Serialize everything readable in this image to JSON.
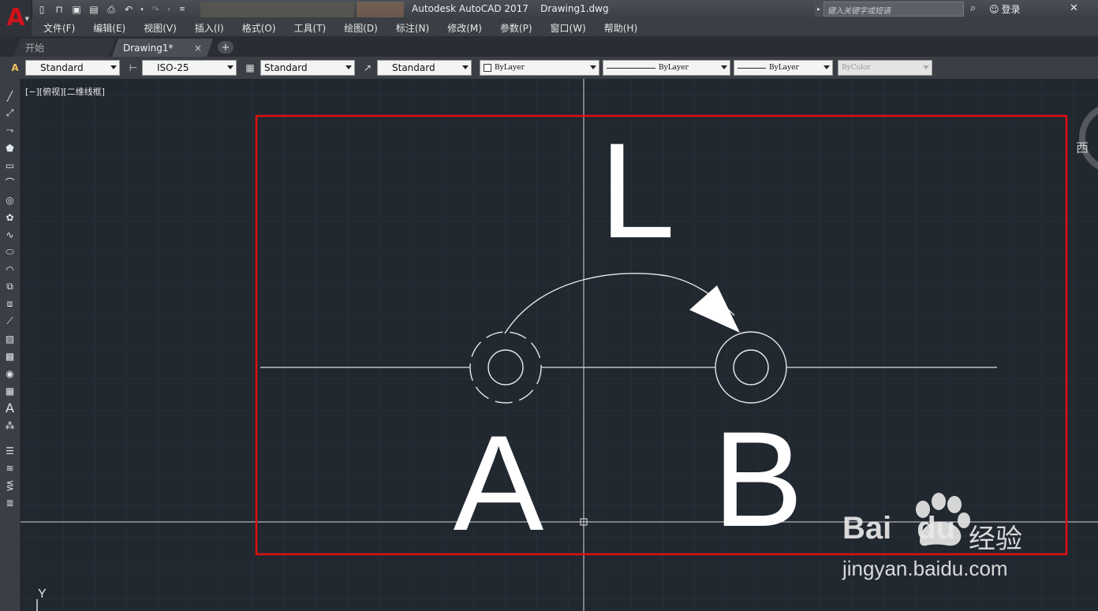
{
  "titlebar": {
    "title": "Autodesk AutoCAD 2017    Drawing1.dwg",
    "search_placeholder": "键入关键字或短语",
    "login": "登录"
  },
  "menu": [
    "文件(F)",
    "编辑(E)",
    "视图(V)",
    "插入(I)",
    "格式(O)",
    "工具(T)",
    "绘图(D)",
    "标注(N)",
    "修改(M)",
    "参数(P)",
    "窗口(W)",
    "帮助(H)"
  ],
  "tabs": {
    "start": "开始",
    "drawing": "Drawing1*",
    "close": "×",
    "add": "+"
  },
  "toolbar": {
    "text_style": "Standard",
    "dim_style": "ISO-25",
    "table_style": "Standard",
    "multileader_style": "Standard",
    "layer_color": "ByLayer",
    "linetype": "ByLayer",
    "lineweight": "ByLayer",
    "plot_style": "ByColor"
  },
  "viewport": {
    "label": "[−][俯视][二维线框]",
    "viewcube_dir": "西",
    "ucs_y": "Y"
  },
  "drawing": {
    "label_top": "L",
    "label_left": "A",
    "label_right": "B",
    "highlight_color": "#e01010"
  },
  "watermark": {
    "brand_bai": "Bai",
    "brand_du": "du",
    "brand_cn": "经验",
    "url": "jingyan.baidu.com"
  }
}
